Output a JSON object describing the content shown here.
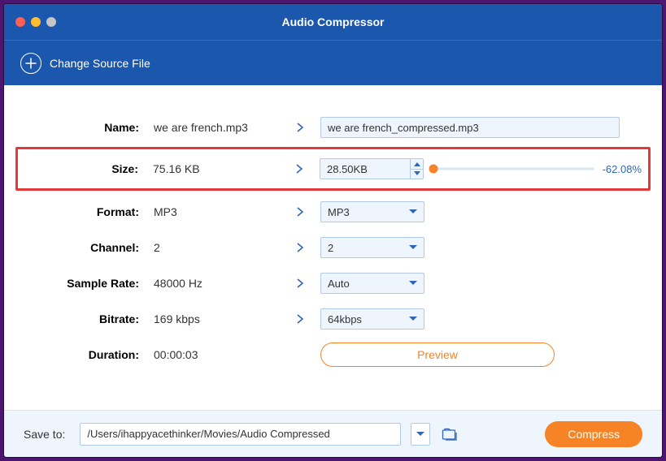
{
  "header": {
    "title": "Audio Compressor",
    "change_source": "Change Source File"
  },
  "rows": {
    "name": {
      "label": "Name:",
      "value": "we are french.mp3",
      "output": "we are french_compressed.mp3"
    },
    "size": {
      "label": "Size:",
      "value": "75.16 KB",
      "target": "28.50KB",
      "pct": "-62.08%"
    },
    "format": {
      "label": "Format:",
      "value": "MP3",
      "select": "MP3"
    },
    "channel": {
      "label": "Channel:",
      "value": "2",
      "select": "2"
    },
    "sample": {
      "label": "Sample Rate:",
      "value": "48000 Hz",
      "select": "Auto"
    },
    "bitrate": {
      "label": "Bitrate:",
      "value": "169 kbps",
      "select": "64kbps"
    },
    "duration": {
      "label": "Duration:",
      "value": "00:00:03",
      "preview": "Preview"
    }
  },
  "footer": {
    "save_label": "Save to:",
    "path": "/Users/ihappyacethinker/Movies/Audio Compressed",
    "compress": "Compress"
  }
}
